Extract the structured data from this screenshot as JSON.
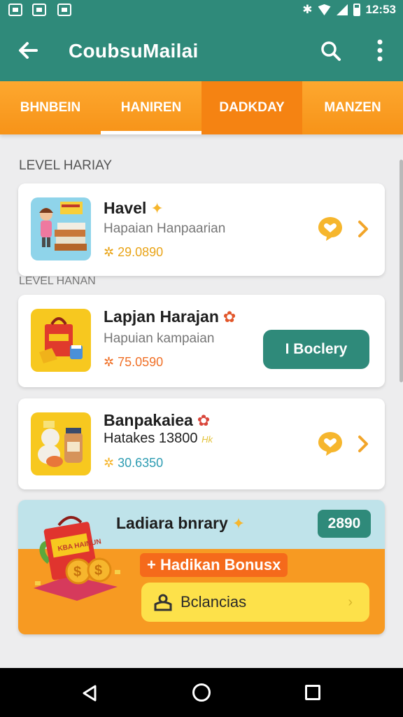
{
  "status_bar": {
    "time": "12:53"
  },
  "app_bar": {
    "title": "CoubsuMailai"
  },
  "tabs": [
    {
      "label": "BHNBEIN"
    },
    {
      "label": "HANIREN"
    },
    {
      "label": "DADKDAY"
    },
    {
      "label": "MANZEN"
    }
  ],
  "sections": {
    "first": "LEVEL HARIAY",
    "second": "LEVEL HANAN"
  },
  "cards": [
    {
      "title": "Havel",
      "subtitle": "Hapaian Hanpaarian",
      "price": "29.0890",
      "price_color": "#e9a418"
    },
    {
      "title": "Lapjan Harajan",
      "subtitle": "Hapuian kampaian",
      "price": "75.0590",
      "price_color": "#f07027",
      "button": "I Boclery"
    },
    {
      "title": "Banpakaiea",
      "subtitle": "Hatakes 13800",
      "subtitle_tag": "Hk",
      "price": "30.6350",
      "price_color": "#2d9cb2"
    }
  ],
  "promo": {
    "title": "Ladiara bnrary",
    "badge": "2890",
    "bonus": "+ Hadikan Bonusx",
    "button": "Bclancias",
    "bag_text": "KBA HAINUN"
  },
  "colors": {
    "primary": "#2f8a7a",
    "accent": "#f79318",
    "star": "#f6b62d"
  }
}
